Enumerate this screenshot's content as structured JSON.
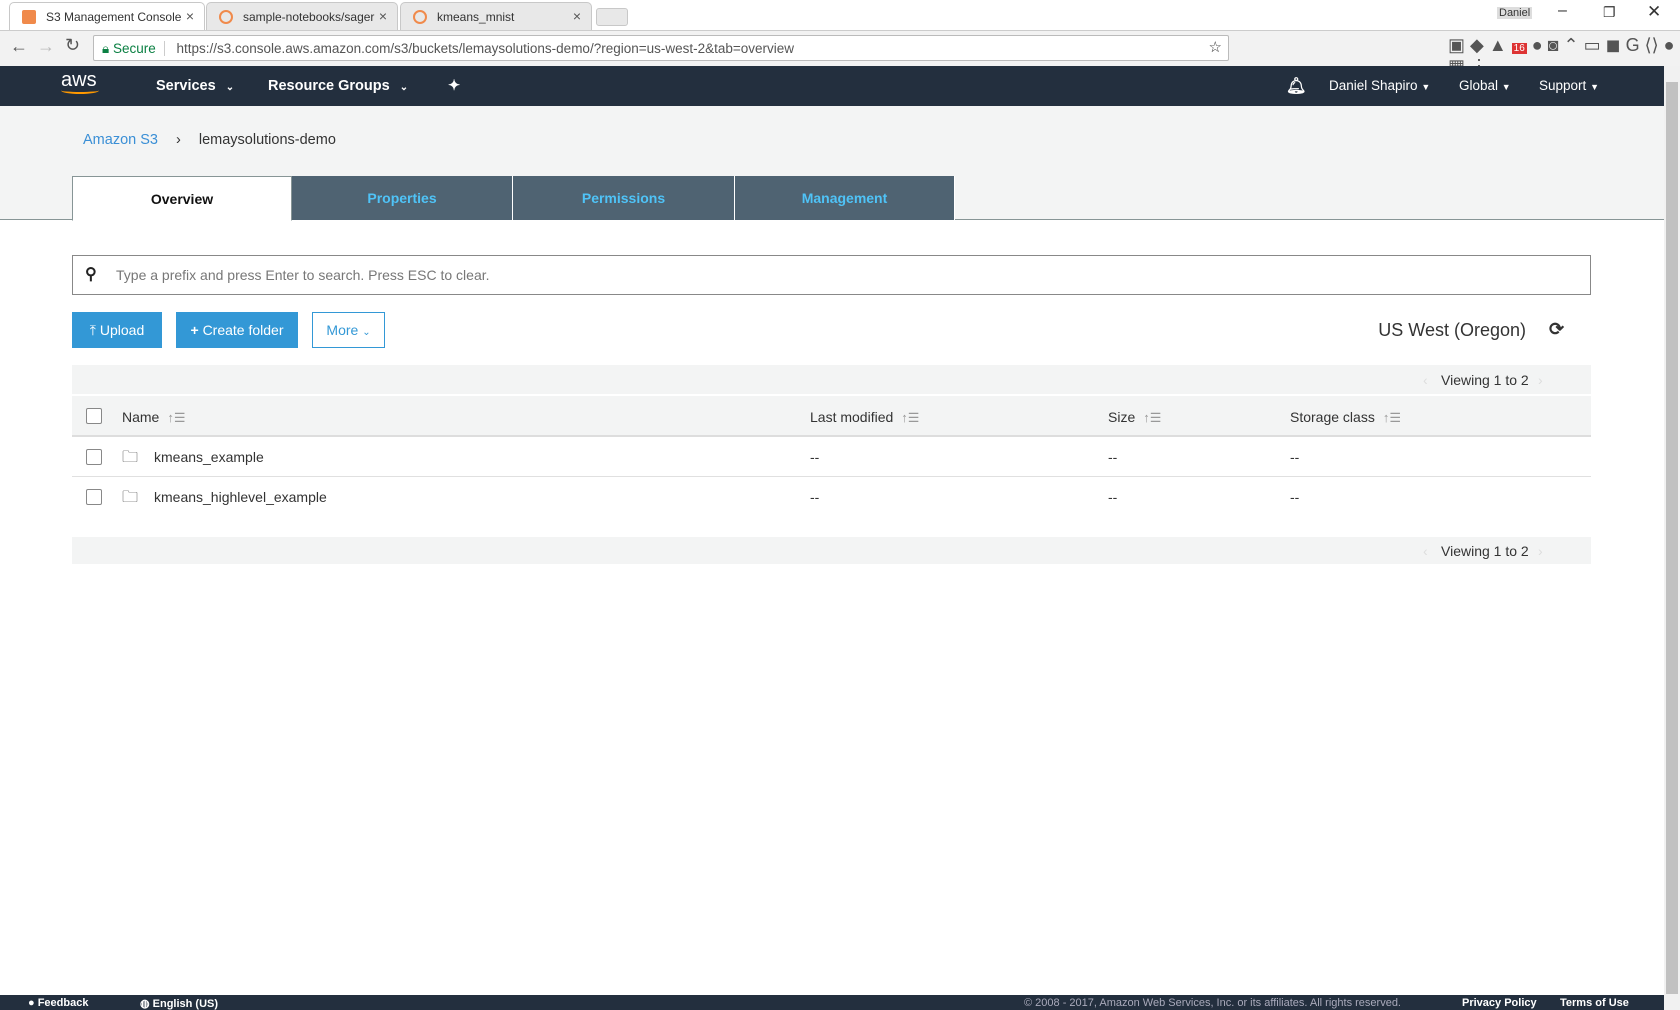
{
  "browser": {
    "tabs": [
      {
        "label": "S3 Management Console"
      },
      {
        "label": "sample-notebooks/sager"
      },
      {
        "label": "kmeans_mnist"
      }
    ],
    "profile": "Daniel",
    "secure_label": "Secure",
    "url": "https://s3.console.aws.amazon.com/s3/buckets/lemaysolutions-demo/?region=us-west-2&tab=overview",
    "extension_badge": "16"
  },
  "nav": {
    "logo": "aws",
    "services": "Services",
    "resource_groups": "Resource Groups",
    "user": "Daniel Shapiro",
    "region": "Global",
    "support": "Support"
  },
  "breadcrumb": {
    "root": "Amazon S3",
    "separator": "›",
    "current": "lemaysolutions-demo"
  },
  "tabs": [
    {
      "label": "Overview"
    },
    {
      "label": "Properties"
    },
    {
      "label": "Permissions"
    },
    {
      "label": "Management"
    }
  ],
  "search": {
    "placeholder": "Type a prefix and press Enter to search. Press ESC to clear."
  },
  "actions": {
    "upload": "Upload",
    "create_folder": "Create folder",
    "more": "More"
  },
  "region_label": "US West (Oregon)",
  "viewing": "Viewing 1 to 2",
  "table": {
    "columns": [
      "Name",
      "Last modified",
      "Size",
      "Storage class"
    ],
    "rows": [
      {
        "name": "kmeans_example",
        "modified": "--",
        "size": "--",
        "storage": "--"
      },
      {
        "name": "kmeans_highlevel_example",
        "modified": "--",
        "size": "--",
        "storage": "--"
      }
    ]
  },
  "footer": {
    "feedback": "Feedback",
    "language": "English (US)",
    "copyright": "© 2008 - 2017, Amazon Web Services, Inc. or its affiliates. All rights reserved.",
    "privacy": "Privacy Policy",
    "terms": "Terms of Use"
  }
}
